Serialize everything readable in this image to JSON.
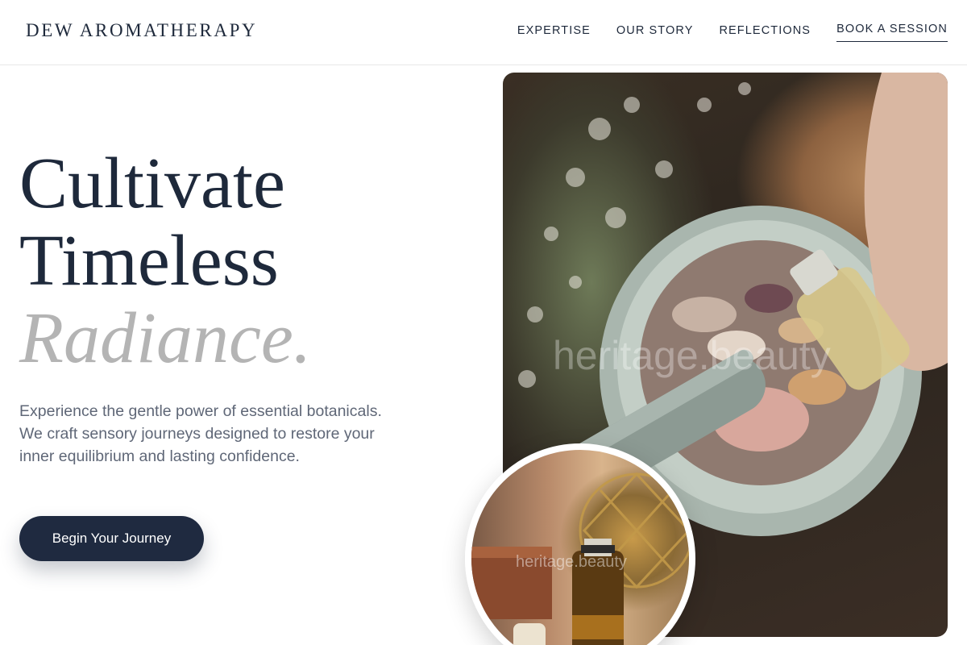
{
  "brand": {
    "name": "DEW AROMATHERAPY"
  },
  "nav": {
    "items": [
      {
        "label": "EXPERTISE"
      },
      {
        "label": "OUR STORY"
      },
      {
        "label": "REFLECTIONS"
      }
    ],
    "cta_label": "BOOK A SESSION"
  },
  "hero": {
    "headline_line1": "Cultivate",
    "headline_line2": "Timeless",
    "headline_accent": "Radiance.",
    "intro": "Experience the gentle power of essential botanicals. We craft sensory journeys designed to restore your inner equilibrium and lasting confidence.",
    "button_label": "Begin Your Journey"
  },
  "images": {
    "main_watermark": "heritage.beauty",
    "inset_watermark": "heritage.beauty",
    "main_subject": "mortar-and-pestle-with-dried-botanicals-photo",
    "inset_subject": "amber-essential-oil-bottle-photo"
  },
  "colors": {
    "primary": "#1f2a40",
    "heading": "#1e293b",
    "accent_text": "#b4b4b4",
    "body_text": "#5f6777",
    "divider": "#e8e8e8"
  }
}
